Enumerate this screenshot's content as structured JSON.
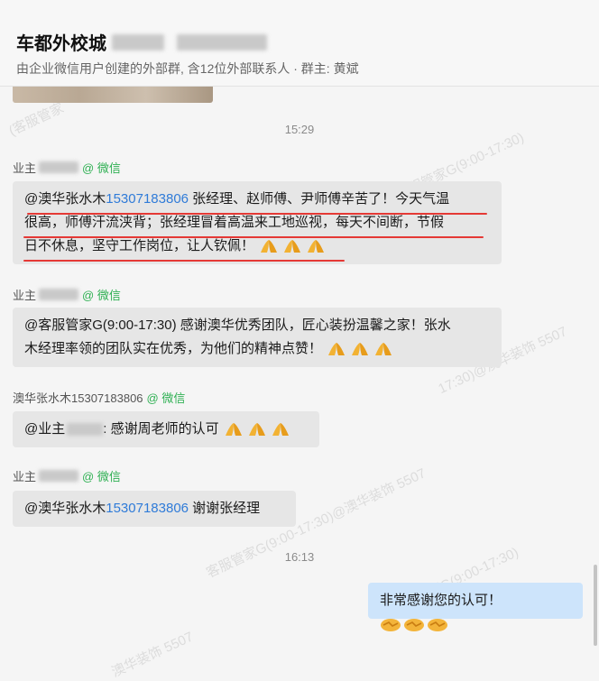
{
  "header": {
    "title": "车都外校城",
    "subtitle": "由企业微信用户创建的外部群, 含12位外部联系人 · 群主: 黄斌"
  },
  "timestamps": [
    "15:29",
    "16:13"
  ],
  "wechat_tag": "@ 微信",
  "messages": [
    {
      "sender": "业主",
      "line1_pre": "@澳华张水木",
      "line1_phone": "15307183806",
      "line1_post": " 张经理、赵师傅、尹师傅辛苦了！今天气温",
      "line2": "很高，师傅汗流浃背；张经理冒着高温来工地巡视，每天不间断，节假",
      "line3": "日不休息，坚守工作岗位，让人钦佩！"
    },
    {
      "sender": "业主",
      "line1": "@客服管家G(9:00-17:30) 感谢澳华优秀团队，匠心装扮温馨之家！张水",
      "line2": "木经理率领的团队实在优秀，为他们的精神点赞！"
    },
    {
      "sender": "澳华张水木15307183806",
      "pre": "@业主",
      "post": ": 感谢周老师的认可"
    },
    {
      "sender": "业主",
      "pre": "@澳华张水木",
      "phone": "15307183806",
      "post": " 谢谢张经理"
    },
    {
      "text": "非常感谢您的认可！"
    }
  ],
  "watermarks": [
    "(客服管家",
    "客服管家G(9:00-17:30)",
    "客服管家G(9:00-17:30)@澳华装饰 5507",
    "17:30)@澳华装饰 5507",
    "客服管家G(9:00-17:30)",
    "澳华装饰 5507"
  ],
  "icons": {
    "praise": "folded-hands-emoji",
    "handshake": "handshake-emoji"
  },
  "colors": {
    "link": "#2f7bd8",
    "wechat": "#2fb053",
    "underline": "#e53935",
    "my_bubble": "#cde4fb"
  }
}
